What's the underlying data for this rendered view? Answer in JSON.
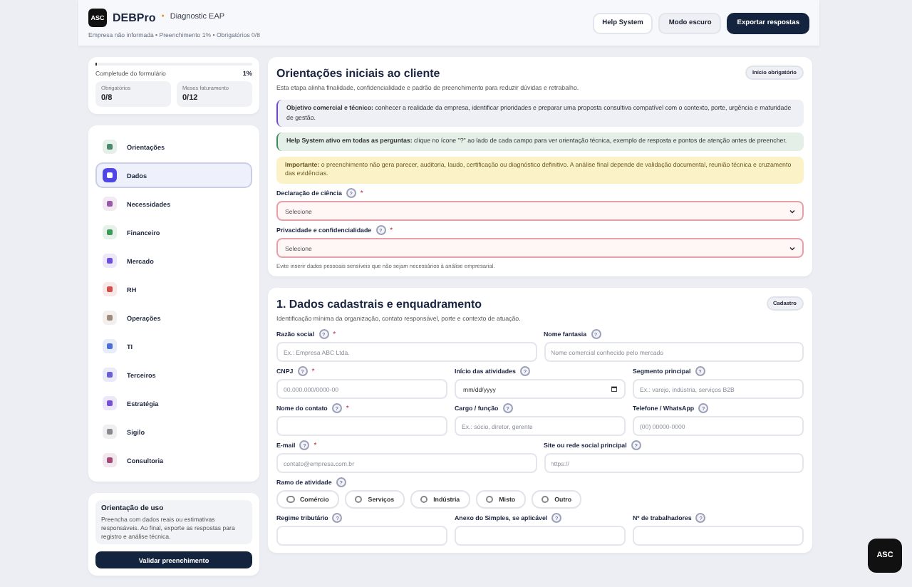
{
  "header": {
    "logo": "ASC",
    "brand": "DEBPro",
    "separator": "•",
    "subtitle": "Diagnostic EAP",
    "meta": "Empresa não informada • Preenchimento 1% • Obrigatórios 0/8",
    "buttons": [
      {
        "label": "Help System",
        "kind": "light"
      },
      {
        "label": "Modo escuro",
        "kind": "gray"
      },
      {
        "label": "Exportar respostas",
        "kind": "dark"
      }
    ]
  },
  "progress": {
    "level": 0.01,
    "label": "Completude do formulário",
    "value": "1%",
    "stats": [
      {
        "label": "Obrigatórios",
        "value": "0/8"
      },
      {
        "label": "Meses faturamento",
        "value": "0/12"
      }
    ]
  },
  "nav": [
    {
      "label": "Orientações",
      "selected": false,
      "color": "#4a8a6a"
    },
    {
      "label": "Dados",
      "selected": true,
      "color": "#4f46e5"
    },
    {
      "label": "Necessidades",
      "selected": false,
      "color": "#9a5aa8"
    },
    {
      "label": "Financeiro",
      "selected": false,
      "color": "#3f9a5a"
    },
    {
      "label": "Mercado",
      "selected": false,
      "color": "#6d4fd8"
    },
    {
      "label": "RH",
      "selected": false,
      "color": "#d0504f"
    },
    {
      "label": "Operações",
      "selected": false,
      "color": "#a08a7a"
    },
    {
      "label": "TI",
      "selected": false,
      "color": "#4a70d0"
    },
    {
      "label": "Terceiros",
      "selected": false,
      "color": "#6a60d0"
    },
    {
      "label": "Estratégia",
      "selected": false,
      "color": "#7a50d0"
    },
    {
      "label": "Sigilo",
      "selected": false,
      "color": "#888a90"
    },
    {
      "label": "Consultoria",
      "selected": false,
      "color": "#a04a78"
    }
  ],
  "guide": {
    "title": "Orientação de uso",
    "text": "Preencha com dados reais ou estimativas responsáveis. Ao final, exporte as respostas para registro e análise técnica.",
    "button": "Validar preenchimento"
  },
  "sections": [
    {
      "title": "Orientações iniciais ao cliente",
      "subtitle": "Esta etapa alinha finalidade, confidencialidade e padrão de preenchimento para reduzir dúvidas e retrabalho.",
      "badge": "Início obrigatório",
      "notes": [
        {
          "kind": "purple",
          "text": "**Objetivo comercial e técnico:** conhecer a realidade da empresa, identificar prioridades e preparar uma proposta consultiva compatível com o contexto, porte, urgência e maturidade de gestão."
        },
        {
          "kind": "green",
          "text": "**Help System ativo em todas as perguntas:** clique no ícone \"?\" ao lado de cada campo para ver orientação técnica, exemplo de resposta e pontos de atenção antes de preencher."
        },
        {
          "kind": "yellow",
          "text": "**Importante:** o preenchimento não gera parecer, auditoria, laudo, certificação ou diagnóstico definitivo. A análise final depende de validação documental, reunião técnica e cruzamento das evidências."
        }
      ],
      "rows": [
        [
          {
            "kind": "select",
            "label": "Declaração de ciência",
            "help": "?",
            "required_mark": "*",
            "invalid": true,
            "value": "Selecione"
          }
        ],
        [
          {
            "kind": "select",
            "label": "Privacidade e confidencialidade",
            "help": "?",
            "required_mark": "*",
            "invalid": true,
            "value": "Selecione"
          }
        ]
      ],
      "hint": "Evite inserir dados pessoais sensíveis que não sejam necessários à análise empresarial."
    },
    {
      "title": "1. Dados cadastrais e enquadramento",
      "subtitle": "Identificação mínima da organização, contato responsável, porte e contexto de atuação.",
      "badge": "Cadastro",
      "rows": [
        [
          {
            "kind": "input",
            "label": "Razão social",
            "help": "?",
            "required_mark": "*",
            "placeholder": "Ex.: Empresa ABC Ltda."
          },
          {
            "kind": "input",
            "label": "Nome fantasia",
            "help": "?",
            "placeholder": "Nome comercial conhecido pelo mercado"
          }
        ],
        [
          {
            "kind": "input",
            "label": "CNPJ",
            "help": "?",
            "required_mark": "*",
            "placeholder": "00.000.000/0000-00"
          },
          {
            "kind": "date",
            "label": "Início das atividades",
            "help": "?",
            "value": "mm/dd/yyyy"
          },
          {
            "kind": "input",
            "label": "Segmento principal",
            "help": "?",
            "placeholder": "Ex.: varejo, indústria, serviços B2B"
          }
        ],
        [
          {
            "kind": "input",
            "label": "Nome do contato",
            "help": "?",
            "required_mark": "*"
          },
          {
            "kind": "input",
            "label": "Cargo / função",
            "help": "?",
            "placeholder": "Ex.: sócio, diretor, gerente"
          },
          {
            "kind": "input",
            "label": "Telefone / WhatsApp",
            "help": "?",
            "placeholder": "(00) 00000-0000"
          }
        ],
        [
          {
            "kind": "input",
            "label": "E-mail",
            "help": "?",
            "required_mark": "*",
            "placeholder": "contato@empresa.com.br"
          },
          {
            "kind": "input",
            "label": "Site ou rede social principal",
            "help": "?",
            "placeholder": "https://"
          }
        ],
        [
          {
            "kind": "radio",
            "label": "Ramo de atividade",
            "help": "?",
            "options": [
              {
                "label": "Comércio",
                "selected": false
              },
              {
                "label": "Serviços",
                "selected": false
              },
              {
                "label": "Indústria",
                "selected": false
              },
              {
                "label": "Misto",
                "selected": false
              },
              {
                "label": "Outro",
                "selected": false
              }
            ]
          }
        ],
        [
          {
            "kind": "input",
            "label": "Regime tributário",
            "help": "?"
          },
          {
            "kind": "input",
            "label": "Anexo do Simples, se aplicável",
            "help": "?"
          },
          {
            "kind": "input",
            "label": "Nº de trabalhadores",
            "help": "?"
          }
        ]
      ]
    }
  ],
  "fab": {
    "label": "ASC"
  }
}
